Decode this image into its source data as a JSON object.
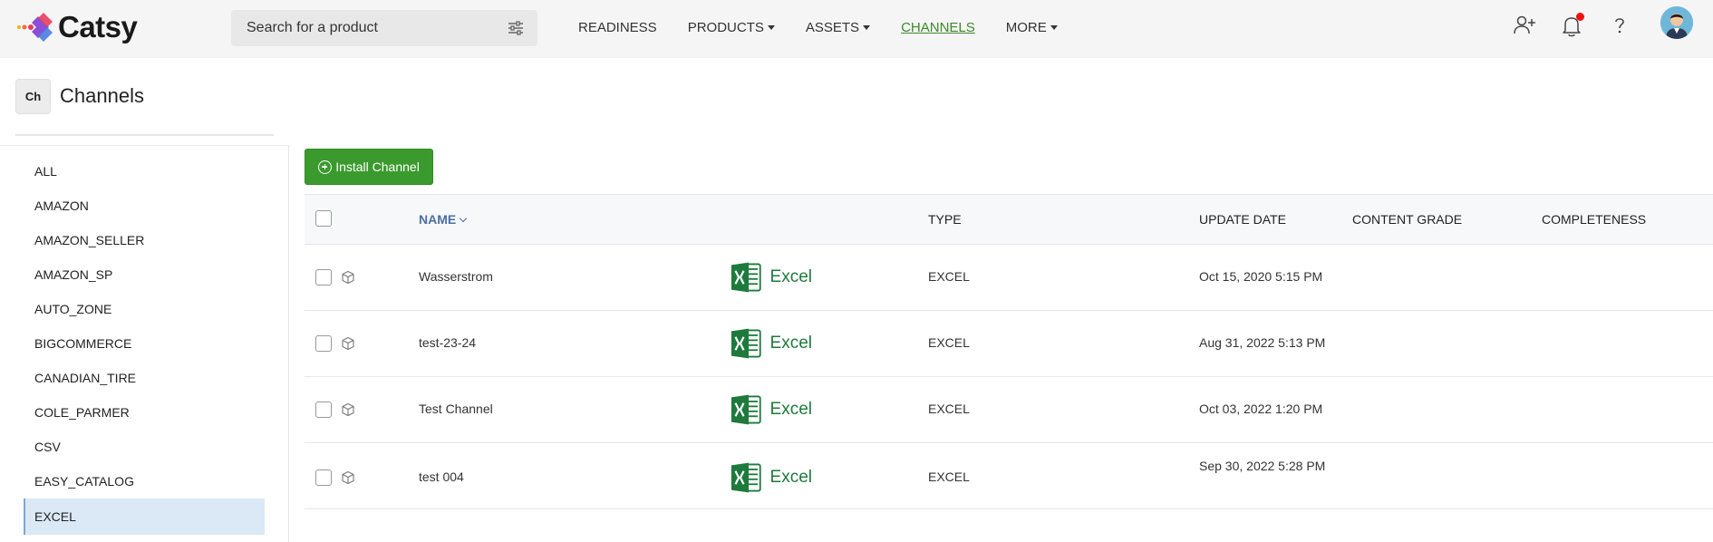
{
  "app": {
    "brand": "Catsy"
  },
  "search": {
    "placeholder": "Search for a product"
  },
  "nav": {
    "items": [
      {
        "label": "READINESS",
        "dropdown": false,
        "active": false
      },
      {
        "label": "PRODUCTS",
        "dropdown": true,
        "active": false
      },
      {
        "label": "ASSETS",
        "dropdown": true,
        "active": false
      },
      {
        "label": "CHANNELS",
        "dropdown": false,
        "active": true
      },
      {
        "label": "MORE",
        "dropdown": true,
        "active": false
      }
    ]
  },
  "header": {
    "badge": "Ch",
    "title": "Channels"
  },
  "sidebar": {
    "items": [
      {
        "label": "ALL"
      },
      {
        "label": "AMAZON"
      },
      {
        "label": "AMAZON_SELLER"
      },
      {
        "label": "AMAZON_SP"
      },
      {
        "label": "AUTO_ZONE"
      },
      {
        "label": "BIGCOMMERCE"
      },
      {
        "label": "CANADIAN_TIRE"
      },
      {
        "label": "COLE_PARMER"
      },
      {
        "label": "CSV"
      },
      {
        "label": "EASY_CATALOG"
      },
      {
        "label": "EXCEL",
        "selected": true
      }
    ]
  },
  "toolbar": {
    "install_label": "Install Channel"
  },
  "table": {
    "columns": {
      "name": "NAME",
      "type": "TYPE",
      "update_date": "UPDATE DATE",
      "content_grade": "CONTENT GRADE",
      "completeness": "COMPLETENESS"
    },
    "logo_text": "Excel",
    "rows": [
      {
        "name": "Wasserstrom",
        "type": "EXCEL",
        "date": "Oct 15, 2020 5:15 PM"
      },
      {
        "name": "test-23-24",
        "type": "EXCEL",
        "date": "Aug 31, 2022 5:13 PM"
      },
      {
        "name": "Test Channel",
        "type": "EXCEL",
        "date": "Oct 03, 2022 1:20 PM"
      },
      {
        "name": "test 004",
        "type": "EXCEL",
        "date": "Sep 30, 2022 5:28 PM"
      }
    ]
  },
  "colors": {
    "accent_green": "#3a9a2e",
    "active_nav": "#3a8a2a",
    "sort_header": "#4a6fa5",
    "selected_bg": "#dbe8f6",
    "excel_green": "#1e7a3c"
  },
  "icons": {
    "filter": "sliders-icon",
    "add_user": "add-user-icon",
    "notifications": "bell-icon",
    "help": "help-icon",
    "row": "cube-icon"
  }
}
